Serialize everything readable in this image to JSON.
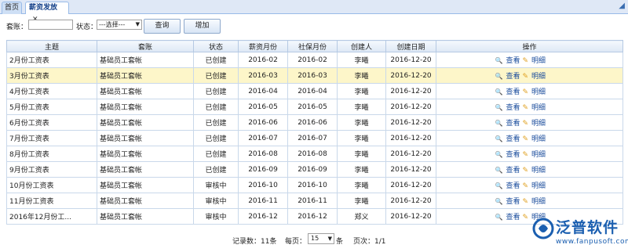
{
  "tabs": {
    "home": "首页",
    "active": "薪资发放",
    "close": "✕",
    "scroll": "◢"
  },
  "filter": {
    "account_label": "套账：",
    "account_value": "",
    "status_label": "状态：",
    "status_selected": "---选择---",
    "query_button": "查询",
    "add_button": "增加"
  },
  "columns": [
    "主题",
    "套账",
    "状态",
    "薪资月份",
    "社保月份",
    "创建人",
    "创建日期",
    "操作"
  ],
  "rows": [
    {
      "subject": "2月份工资表",
      "account": "基础员工套帐",
      "status": "已创建",
      "salary_month": "2016-02",
      "ss_month": "2016-02",
      "creator": "李曦",
      "date": "2016-12-20"
    },
    {
      "subject": "3月份工资表",
      "account": "基础员工套帐",
      "status": "已创建",
      "salary_month": "2016-03",
      "ss_month": "2016-03",
      "creator": "李曦",
      "date": "2016-12-20"
    },
    {
      "subject": "4月份工资表",
      "account": "基础员工套帐",
      "status": "已创建",
      "salary_month": "2016-04",
      "ss_month": "2016-04",
      "creator": "李曦",
      "date": "2016-12-20"
    },
    {
      "subject": "5月份工资表",
      "account": "基础员工套帐",
      "status": "已创建",
      "salary_month": "2016-05",
      "ss_month": "2016-05",
      "creator": "李曦",
      "date": "2016-12-20"
    },
    {
      "subject": "6月份工资表",
      "account": "基础员工套帐",
      "status": "已创建",
      "salary_month": "2016-06",
      "ss_month": "2016-06",
      "creator": "李曦",
      "date": "2016-12-20"
    },
    {
      "subject": "7月份工资表",
      "account": "基础员工套帐",
      "status": "已创建",
      "salary_month": "2016-07",
      "ss_month": "2016-07",
      "creator": "李曦",
      "date": "2016-12-20"
    },
    {
      "subject": "8月份工资表",
      "account": "基础员工套帐",
      "status": "已创建",
      "salary_month": "2016-08",
      "ss_month": "2016-08",
      "creator": "李曦",
      "date": "2016-12-20"
    },
    {
      "subject": "9月份工资表",
      "account": "基础员工套帐",
      "status": "已创建",
      "salary_month": "2016-09",
      "ss_month": "2016-09",
      "creator": "李曦",
      "date": "2016-12-20"
    },
    {
      "subject": "10月份工资表",
      "account": "基础员工套帐",
      "status": "审核中",
      "salary_month": "2016-10",
      "ss_month": "2016-10",
      "creator": "李曦",
      "date": "2016-12-20"
    },
    {
      "subject": "11月份工资表",
      "account": "基础员工套帐",
      "status": "审核中",
      "salary_month": "2016-11",
      "ss_month": "2016-11",
      "creator": "李曦",
      "date": "2016-12-20"
    },
    {
      "subject": "2016年12月份工...",
      "account": "基础员工套帐",
      "status": "审核中",
      "salary_month": "2016-12",
      "ss_month": "2016-12",
      "creator": "郑义",
      "date": "2016-12-20"
    }
  ],
  "actions": {
    "view": "查看",
    "detail": "明细"
  },
  "pager": {
    "records_label": "记录数：11条",
    "per_page_label": "每页：",
    "per_page_value": "15",
    "per_page_unit": "条",
    "pages_label": "页次：1/1"
  },
  "logo": {
    "name": "泛普软件",
    "url": "www.fanpusoft.com",
    "color": "#1b5fb0"
  },
  "highlight_color": "#fdf6c9"
}
